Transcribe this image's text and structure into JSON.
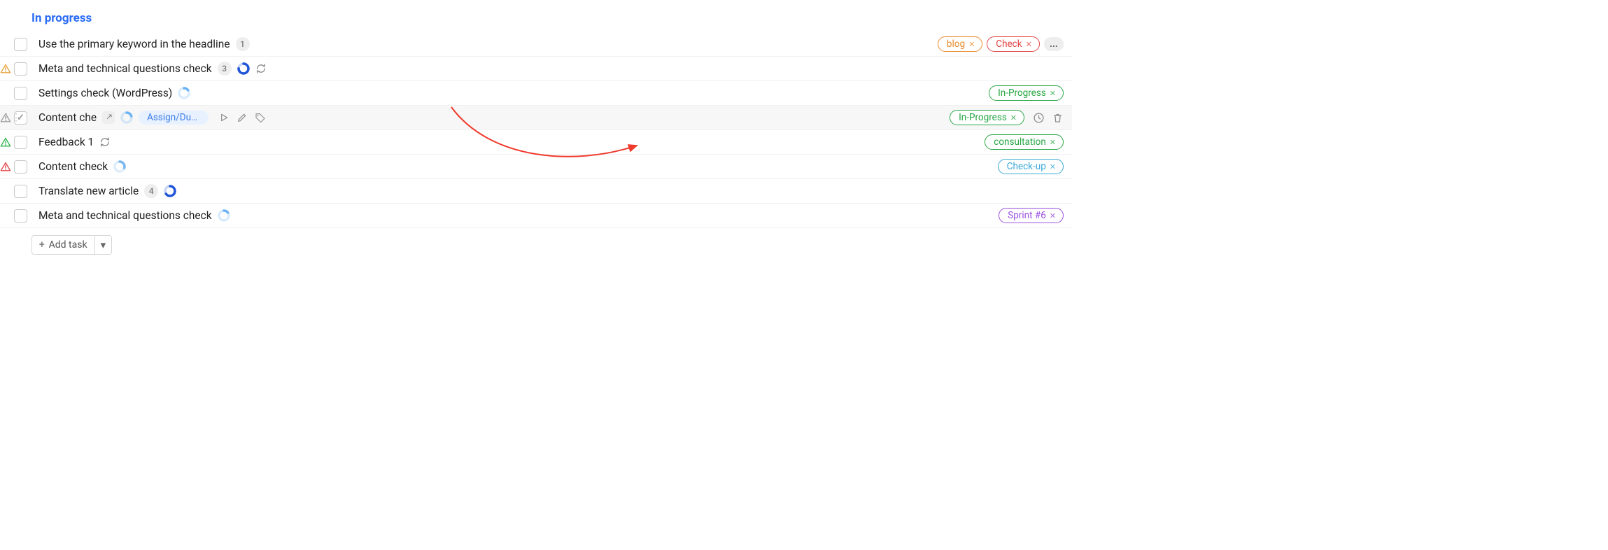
{
  "section": {
    "title": "In progress"
  },
  "tasks": [
    {
      "title": "Use the primary keyword in the headline",
      "count": "1",
      "tags": [
        {
          "label": "blog",
          "color": "#e98b2e"
        },
        {
          "label": "Check",
          "color": "#e24545"
        }
      ],
      "show_more": true
    },
    {
      "title": "Meta and technical questions check",
      "count": "3",
      "priority_color": "#e9a23c",
      "progress": {
        "stroke": "#2256d8",
        "pct": 0.75
      },
      "recurring": true
    },
    {
      "title": "Settings check (WordPress)",
      "progress": {
        "stroke": "#6cb3f4",
        "pct": 0.15
      },
      "tags": [
        {
          "label": "In-Progress",
          "color": "#28a745"
        }
      ]
    },
    {
      "title": "Content che",
      "priority_color": "#9e9e9e",
      "checked": true,
      "hovered": true,
      "open_link": true,
      "progress": {
        "stroke": "#6cb3f4",
        "pct": 0.2
      },
      "assign_due": "Assign/Due...",
      "hover_actions": true,
      "tags": [
        {
          "label": "In-Progress",
          "color": "#28a745"
        }
      ],
      "trail_icons": true
    },
    {
      "title": "Feedback 1",
      "priority_color": "#2bb24c",
      "recurring": true,
      "tags": [
        {
          "label": "consultation",
          "color": "#28a745"
        }
      ]
    },
    {
      "title": "Content check",
      "priority_color": "#e24545",
      "progress": {
        "stroke": "#7cb8f0",
        "pct": 0.3
      },
      "tags": [
        {
          "label": "Check-up",
          "color": "#3aa9d8"
        }
      ]
    },
    {
      "title": "Translate new article",
      "count": "4",
      "progress": {
        "stroke": "#2256d8",
        "pct": 0.65
      }
    },
    {
      "title": "Meta and technical questions check",
      "progress": {
        "stroke": "#6cb3f4",
        "pct": 0.15
      },
      "tags": [
        {
          "label": "Sprint #6",
          "color": "#9b4fe0"
        }
      ]
    }
  ],
  "add_task": {
    "label": "Add task"
  },
  "icons": {
    "plus": "+",
    "caret": "▾",
    "more": "..."
  }
}
